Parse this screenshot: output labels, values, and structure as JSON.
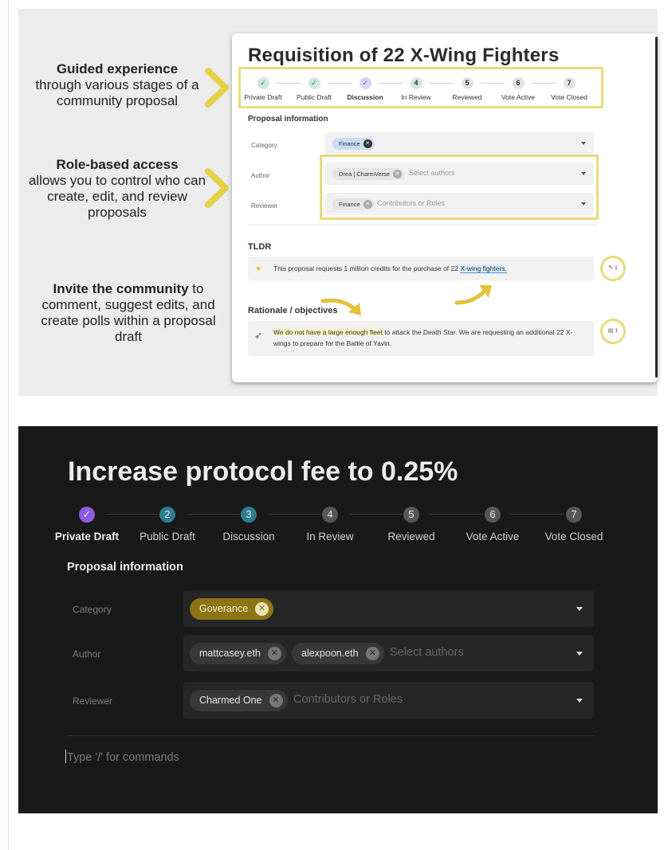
{
  "features": [
    {
      "bold": "Guided experience",
      "text": "through various stages of a community proposal"
    },
    {
      "bold": "Role-based access",
      "text": "allows you to control who can create, edit, and review proposals"
    },
    {
      "bold": "Invite the community",
      "text": " to comment, suggest edits, and create polls within a proposal draft"
    }
  ],
  "light_card": {
    "title": "Requisition of 22 X-Wing Fighters",
    "steps": [
      {
        "label": "Private Draft",
        "icon": "✓"
      },
      {
        "label": "Public Draft",
        "icon": "✓"
      },
      {
        "label": "Discussion",
        "icon": "✓"
      },
      {
        "label": "In Review",
        "icon": "4"
      },
      {
        "label": "Reviewed",
        "icon": "5"
      },
      {
        "label": "Vote Active",
        "icon": "6"
      },
      {
        "label": "Vote Closed",
        "icon": "7"
      }
    ],
    "proposal_info": "Proposal information",
    "category_label": "Category",
    "category_chip": "Finance",
    "author_label": "Author",
    "author_chip": "Drea | CharmVerse",
    "author_placeholder": "Select authors",
    "reviewer_label": "Reviewer",
    "reviewer_chip": "Finance",
    "reviewer_placeholder": "Contributors or Roles",
    "tldr_heading": "TLDR",
    "tldr_text": "This proposal requests 1 million credits for the purchase of 22 ",
    "tldr_highlight": "X-wing fighters.",
    "rationale_heading": "Rationale / objectives",
    "rationale_highlight": "We do not have a large enough fleet",
    "rationale_text": " to attack the Death Star. We are requesting an additional 22 X-wings to prepare for the Battle of Yavin.",
    "suggestion_count": "1",
    "comment_count": "1"
  },
  "dark_card": {
    "title": "Increase protocol fee to 0.25%",
    "steps": [
      {
        "label": "Private Draft",
        "icon": "✓"
      },
      {
        "label": "Public Draft",
        "icon": "2"
      },
      {
        "label": "Discussion",
        "icon": "3"
      },
      {
        "label": "In Review",
        "icon": "4"
      },
      {
        "label": "Reviewed",
        "icon": "5"
      },
      {
        "label": "Vote Active",
        "icon": "6"
      },
      {
        "label": "Vote Closed",
        "icon": "7"
      }
    ],
    "proposal_info": "Proposal information",
    "category_label": "Category",
    "category_chip": "Goverance",
    "author_label": "Author",
    "author_chips": [
      "mattcasey.eth",
      "alexpoon.eth"
    ],
    "author_placeholder": "Select authors",
    "reviewer_label": "Reviewer",
    "reviewer_chip": "Charmed One",
    "reviewer_placeholder": "Contributors or Roles",
    "command_placeholder": "Type '/' for commands"
  },
  "colors": {
    "accent_yellow": "#e7dc7a",
    "purple": "#8e5ce6",
    "teal": "#2f7d8f",
    "gold_chip": "#8c7412",
    "dark_bg": "#191919"
  }
}
